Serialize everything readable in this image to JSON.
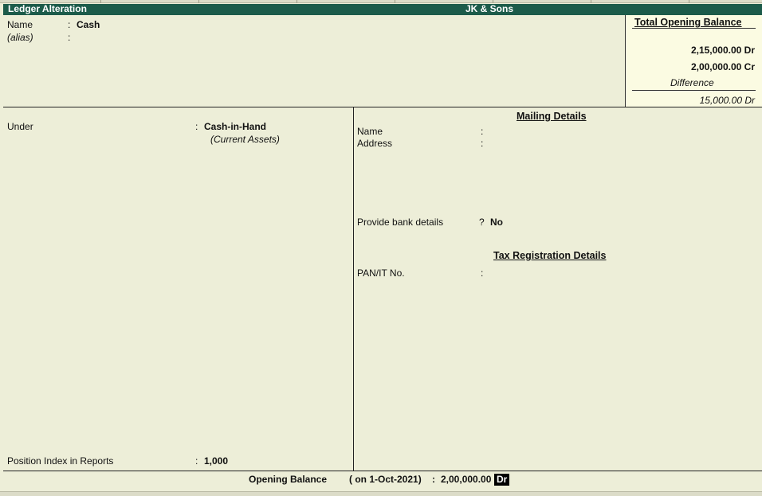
{
  "window": {
    "screen_title": "Ledger Alteration",
    "company_name": "JK & Sons"
  },
  "header": {
    "name_label": "Name",
    "name_colon": ":",
    "name_value": "Cash",
    "alias_label": "(alias)",
    "alias_colon": ":"
  },
  "total_opening_balance": {
    "title": "Total Opening Balance",
    "debit_value": "2,15,000.00 Dr",
    "credit_value": "2,00,000.00 Cr",
    "difference_label": "Difference",
    "difference_value": "15,000.00 Dr"
  },
  "left_panel": {
    "under_label": "Under",
    "under_colon": ":",
    "under_value": "Cash-in-Hand",
    "under_parent": "(Current Assets)",
    "position_label": "Position Index in Reports",
    "position_colon": ":",
    "position_value": "1,000"
  },
  "mailing": {
    "heading": "Mailing Details",
    "name_label": "Name",
    "name_colon": ":",
    "address_label": "Address",
    "address_colon": ":",
    "bank_label": "Provide bank details",
    "bank_mark": "?",
    "bank_value": "No"
  },
  "tax": {
    "heading": "Tax Registration Details",
    "pan_label": "PAN/IT No.",
    "pan_colon": ":"
  },
  "footer": {
    "opening_balance_label": "Opening Balance",
    "date_text": "( on 1-Oct-2021)",
    "colon": ":",
    "amount": "2,00,000.00",
    "dr_cr": "Dr"
  },
  "colors": {
    "background": "#edeed8",
    "title_bar": "#1c5b4a",
    "balance_box": "#fbfbe2"
  }
}
